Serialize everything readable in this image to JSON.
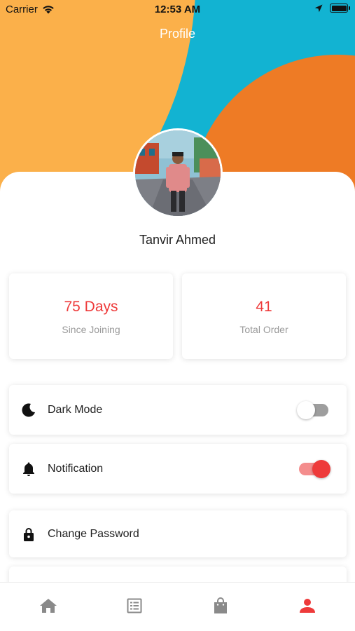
{
  "status_bar": {
    "carrier": "Carrier",
    "time": "12:53 AM"
  },
  "header": {
    "title": "Profile"
  },
  "user": {
    "name": "Tanvir Ahmed"
  },
  "stats": [
    {
      "value": "75 Days",
      "label": "Since Joining"
    },
    {
      "value": "41",
      "label": "Total Order"
    }
  ],
  "settings": [
    {
      "label": "Dark Mode",
      "icon": "moon-icon",
      "toggle": false
    },
    {
      "label": "Notification",
      "icon": "bell-icon",
      "toggle": true
    },
    {
      "label": "Change Password",
      "icon": "lock-icon"
    }
  ],
  "tabs": [
    {
      "icon": "home-icon",
      "active": false
    },
    {
      "icon": "list-icon",
      "active": false
    },
    {
      "icon": "shopping-bag-icon",
      "active": false
    },
    {
      "icon": "person-icon",
      "active": true
    }
  ],
  "colors": {
    "accent": "#ee3a3a",
    "hero_yellow": "#fbb04a",
    "hero_orange": "#ee7b25",
    "hero_blue": "#12b3d2"
  }
}
